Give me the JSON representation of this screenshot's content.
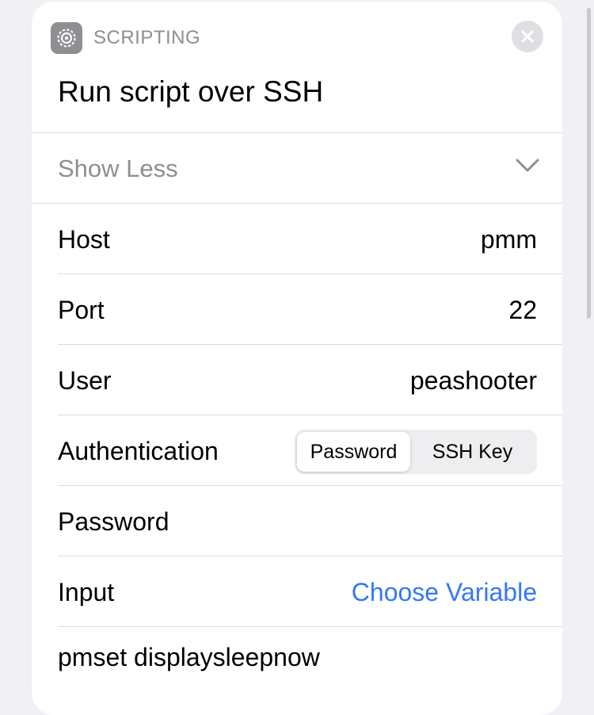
{
  "action": {
    "category": "SCRIPTING",
    "title": "Run script over SSH",
    "category_icon": "gear-icon",
    "close_icon": "close-icon"
  },
  "show_less": {
    "label": "Show Less",
    "icon": "chevron-down-icon"
  },
  "params": {
    "host": {
      "label": "Host",
      "value": "pmm"
    },
    "port": {
      "label": "Port",
      "value": "22"
    },
    "user": {
      "label": "User",
      "value": "peashooter"
    },
    "authentication": {
      "label": "Authentication",
      "options": [
        "Password",
        "SSH Key"
      ],
      "selected": "Password"
    },
    "password": {
      "label": "Password",
      "value": ""
    },
    "input": {
      "label": "Input",
      "value": "Choose Variable"
    }
  },
  "script": {
    "text": "pmset displaysleepnow"
  },
  "colors": {
    "accent": "#3478f6",
    "secondary_text": "#8e8e93",
    "background": "#f0f0f5"
  }
}
